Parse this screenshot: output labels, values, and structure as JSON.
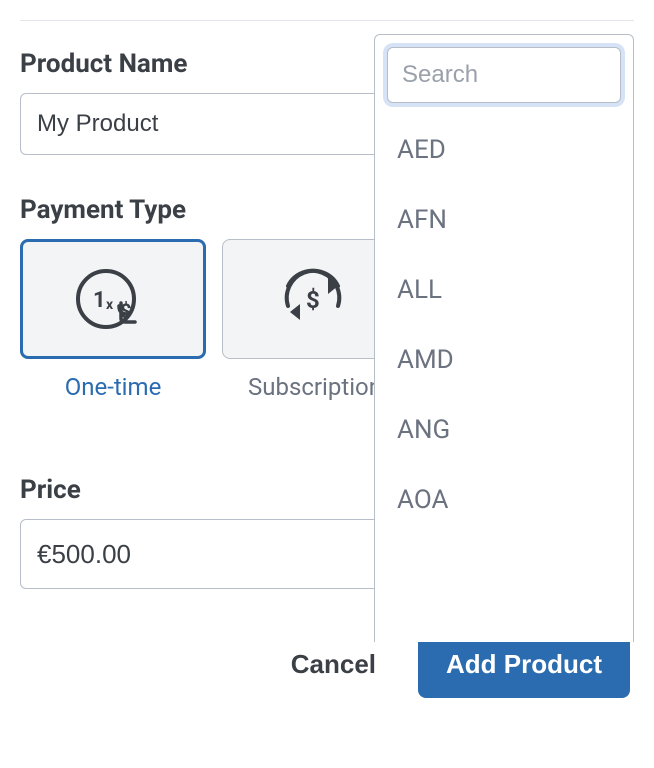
{
  "product_name": {
    "label": "Product Name",
    "value": "My Product"
  },
  "payment_type": {
    "label": "Payment Type",
    "options": {
      "one_time": "One-time",
      "subscription": "Subscription"
    }
  },
  "price": {
    "label": "Price",
    "value": "€500.00"
  },
  "currency": {
    "selected": "EUR",
    "search_placeholder": "Search",
    "options": [
      "AED",
      "AFN",
      "ALL",
      "AMD",
      "ANG",
      "AOA"
    ]
  },
  "actions": {
    "cancel": "Cancel",
    "submit": "Add Product"
  }
}
